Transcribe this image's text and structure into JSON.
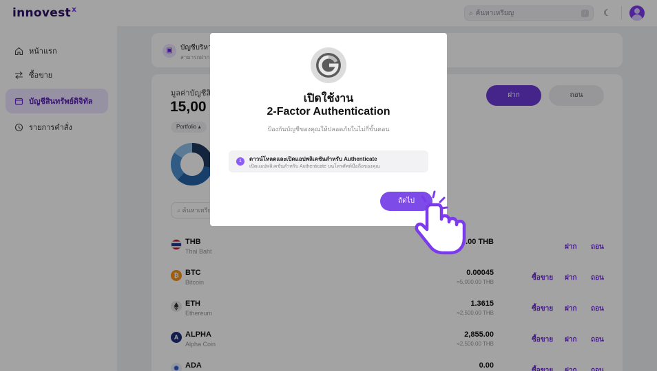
{
  "header": {
    "logo_text": "innovest",
    "logo_mark": "x",
    "search_placeholder": "ค้นหาเหรียญ",
    "search_shortcut": "/"
  },
  "sidebar": {
    "items": [
      {
        "label": "หน้าแรก",
        "icon": "home-icon",
        "active": false
      },
      {
        "label": "ซื้อขาย",
        "icon": "swap-icon",
        "active": false
      },
      {
        "label": "บัญชีสินทรัพย์ดิจิทัล",
        "icon": "wallet-icon",
        "active": true
      },
      {
        "label": "รายการคำสั่ง",
        "icon": "clock-icon",
        "active": false
      }
    ]
  },
  "account": {
    "title": "บัญชีบริหา",
    "subtitle": "สามารถฝากถอ"
  },
  "portfolio": {
    "balance_label": "มูลค่าบัญชีสิ",
    "balance_value": "15,00",
    "filter_label": "Portfolio ▴",
    "deposit_label": "ฝาก",
    "withdraw_label": "ถอน",
    "search_placeholder": "ค้นหาเหรีย",
    "donut_colors": [
      "#1e3a5f",
      "#2563a6",
      "#4a8fd0",
      "#8fbfe9"
    ],
    "donut_shares": [
      0.28,
      0.34,
      0.22,
      0.16
    ]
  },
  "assets": [
    {
      "symbol": "THB",
      "name": "Thai Baht",
      "amount": "0.00 THB",
      "fiat": "",
      "buy": "",
      "deposit": "ฝาก",
      "withdraw": "ถอน",
      "color": "#1f3a93"
    },
    {
      "symbol": "BTC",
      "name": "Bitcoin",
      "amount": "0.00045",
      "fiat": "≈5,000.00 THB",
      "buy": "ซื้อขาย",
      "deposit": "ฝาก",
      "withdraw": "ถอน",
      "color": "#f7931a"
    },
    {
      "symbol": "ETH",
      "name": "Ethereum",
      "amount": "1.3615",
      "fiat": "≈2,500.00 THB",
      "buy": "ซื้อขาย",
      "deposit": "ฝาก",
      "withdraw": "ถอน",
      "color": "#e6e6ea"
    },
    {
      "symbol": "ALPHA",
      "name": "Alpha Coin",
      "amount": "2,855.00",
      "fiat": "≈2,500.00 THB",
      "buy": "ซื้อขาย",
      "deposit": "ฝาก",
      "withdraw": "ถอน",
      "color": "#1e2f7a"
    },
    {
      "symbol": "ADA",
      "name": "",
      "amount": "0.00",
      "fiat": "",
      "buy": "ซื้อขาย",
      "deposit": "ฝาก",
      "withdraw": "ถอน",
      "color": "#e8eefc"
    }
  ],
  "modal": {
    "title_line1": "เปิดใช้งาน",
    "title_line2": "2-Factor Authentication",
    "subtitle": "ป้องกันบัญชีของคุณให้ปลอดภัยในไม่กี่ขั้นตอน",
    "step_number": "1",
    "step_title": "ดาวน์โหลดและเปิดแอปพลิเคชันสำหรับ Authenticate",
    "step_desc": "เปิดแอปพลิเคชันสำหรับ Authenticate บนโทรศัพท์มือถือของคุณ",
    "next_label": "ถัดไป",
    "icon": "google-authenticator-icon"
  }
}
